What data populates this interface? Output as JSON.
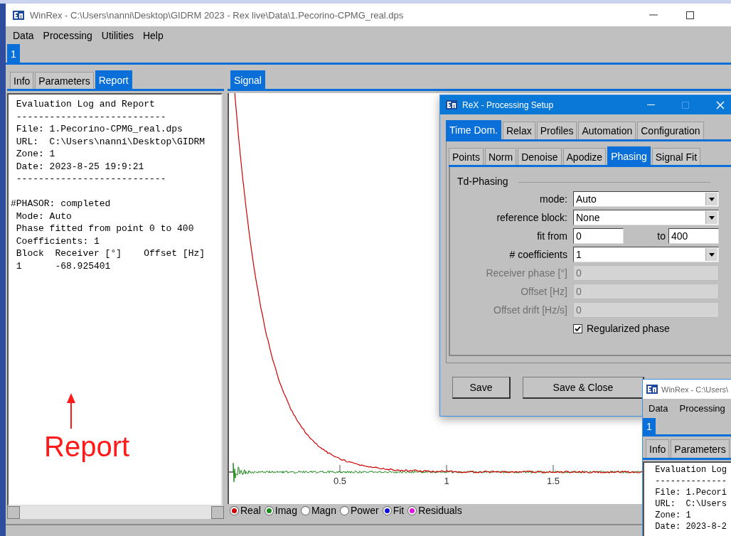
{
  "window": {
    "title": "WinRex - C:\\Users\\nanni\\Desktop\\GIDRM 2023 - Rex live\\Data\\1.Pecorino-CPMG_real.dps"
  },
  "menu": [
    "Data",
    "Processing",
    "Utilities",
    "Help"
  ],
  "document_tabs": [
    {
      "label": "1",
      "selected": true
    }
  ],
  "left_panel": {
    "tabs": [
      {
        "label": "Info",
        "selected": false
      },
      {
        "label": "Parameters",
        "selected": false
      },
      {
        "label": "Report",
        "selected": true
      }
    ],
    "report_blocks": [
      [
        " Evaluation Log and Report",
        " ---------------------------",
        " File: 1.Pecorino-CPMG_real.dps",
        " URL:  C:\\Users\\nanni\\Desktop\\GIDRM",
        " Zone: 1",
        " Date: 2023-8-25 19:9:21",
        " ---------------------------"
      ],
      [
        "#PHASOR: completed",
        " Mode: Auto",
        " Phase fitted from point 0 to 400",
        " Coefficients: 1",
        " Block  Receiver [°]    Offset [Hz]",
        " 1      -68.925401"
      ]
    ]
  },
  "signal_panel": {
    "tabs": [
      {
        "label": "Signal",
        "selected": true
      }
    ],
    "x_tick_labels": [
      "0.5",
      "1",
      "1.5"
    ],
    "legend": [
      {
        "label": "Real",
        "color": "#d00000"
      },
      {
        "label": "Imag",
        "color": "#1a8a1a"
      },
      {
        "label": "Magn"
      },
      {
        "label": "Power"
      },
      {
        "label": "Fit",
        "color": "#1010e0"
      },
      {
        "label": "Residuals",
        "color": "#e010e0"
      }
    ]
  },
  "annotation": {
    "text": "Report"
  },
  "processing_dialog": {
    "title": "ReX - Processing Setup",
    "tabs": [
      {
        "label": "Time Dom.",
        "selected": true
      },
      {
        "label": "Relax",
        "selected": false
      },
      {
        "label": "Profiles",
        "selected": false
      },
      {
        "label": "Automation",
        "selected": false
      },
      {
        "label": "Configuration",
        "selected": false
      }
    ],
    "subtabs": [
      {
        "label": "Points",
        "selected": false
      },
      {
        "label": "Norm",
        "selected": false
      },
      {
        "label": "Denoise",
        "selected": false
      },
      {
        "label": "Apodize",
        "selected": false
      },
      {
        "label": "Phasing",
        "selected": true
      },
      {
        "label": "Signal Fit",
        "selected": false
      }
    ],
    "group": "Td-Phasing",
    "fields": [
      {
        "kind": "dropdown",
        "label": "mode:",
        "value": "Auto",
        "disabled": false
      },
      {
        "kind": "dropdown",
        "label": "reference block:",
        "value": "None",
        "disabled": false
      },
      {
        "kind": "range",
        "label": "fit from",
        "value": "0",
        "to_label": "to",
        "to_value": "400",
        "disabled": false
      },
      {
        "kind": "dropdown",
        "label": "# coefficients",
        "value": "1",
        "disabled": false
      },
      {
        "kind": "text",
        "label": "Receiver phase [°]",
        "value": "0",
        "disabled": true
      },
      {
        "kind": "text",
        "label": "Offset [Hz]",
        "value": "0",
        "disabled": true
      },
      {
        "kind": "text",
        "label": "Offset drift [Hz/s]",
        "value": "0",
        "disabled": true
      }
    ],
    "checkbox": {
      "label": "Regularized phase",
      "checked": true
    },
    "buttons": [
      "Save",
      "Save & Close"
    ]
  },
  "second_window": {
    "title": "WinRex - C:\\Users\\",
    "menu": [
      "Data",
      "Processing"
    ],
    "document_tabs": [
      {
        "label": "1",
        "selected": true
      }
    ],
    "tabs": [
      {
        "label": "Info",
        "selected": false
      },
      {
        "label": "Parameters",
        "selected": false
      }
    ],
    "report_lines": [
      " Evaluation Log",
      " --------------",
      " File: 1.Pecori",
      " URL:  C:\\Users",
      " Zone: 1",
      " Date: 2023-8-2"
    ]
  }
}
